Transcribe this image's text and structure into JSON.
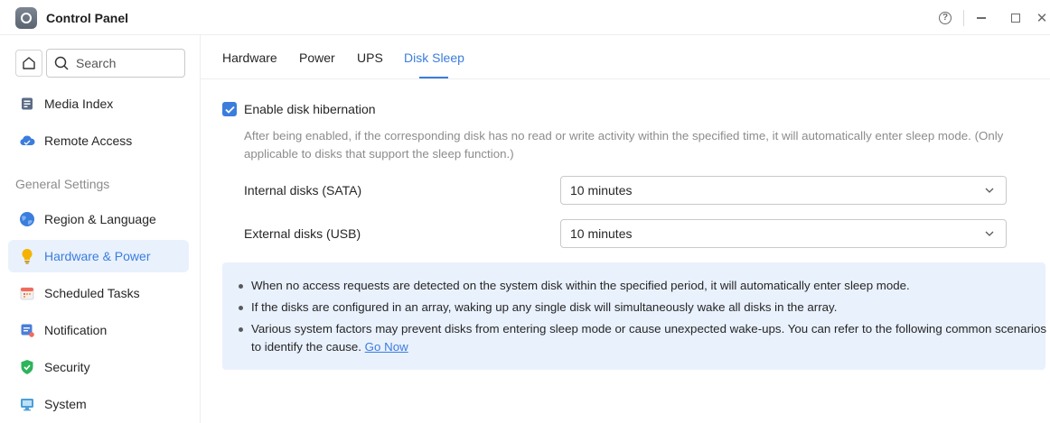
{
  "window": {
    "title": "Control Panel"
  },
  "sidebar": {
    "search_placeholder": "Search",
    "items": [
      {
        "label": "Media Index",
        "icon": "media-index-icon"
      },
      {
        "label": "Remote Access",
        "icon": "cloud-icon"
      }
    ],
    "section_label": "General Settings",
    "general_items": [
      {
        "label": "Region & Language",
        "icon": "globe-icon"
      },
      {
        "label": "Hardware & Power",
        "icon": "lightbulb-icon",
        "active": true
      },
      {
        "label": "Scheduled Tasks",
        "icon": "calendar-icon"
      },
      {
        "label": "Notification",
        "icon": "notification-icon"
      },
      {
        "label": "Security",
        "icon": "shield-icon"
      },
      {
        "label": "System",
        "icon": "monitor-icon"
      }
    ]
  },
  "tabs": [
    {
      "label": "Hardware"
    },
    {
      "label": "Power"
    },
    {
      "label": "UPS"
    },
    {
      "label": "Disk Sleep",
      "active": true
    }
  ],
  "disk_sleep": {
    "enable_label": "Enable disk hibernation",
    "enabled": true,
    "description": "After being enabled, if the corresponding disk has no read or write activity within the specified time, it will automatically enter sleep mode. (Only applicable to disks that support the sleep function.)",
    "internal_label": "Internal disks (SATA)",
    "internal_value": "10 minutes",
    "external_label": "External disks (USB)",
    "external_value": "10 minutes",
    "notes": {
      "note1": "When no access requests are detected on the system disk within the specified period, it will automatically enter sleep mode.",
      "note2": "If the disks are configured in an array, waking up any single disk will simultaneously wake all disks in the array.",
      "note3": "Various system factors may prevent disks from entering sleep mode or cause unexpected wake-ups. You can refer to the following common scenarios to identify the cause.",
      "link": "Go Now"
    }
  },
  "colors": {
    "accent": "#3b7ddd",
    "info_bg": "#e9f1fd",
    "active_bg": "#e9f1fd"
  }
}
